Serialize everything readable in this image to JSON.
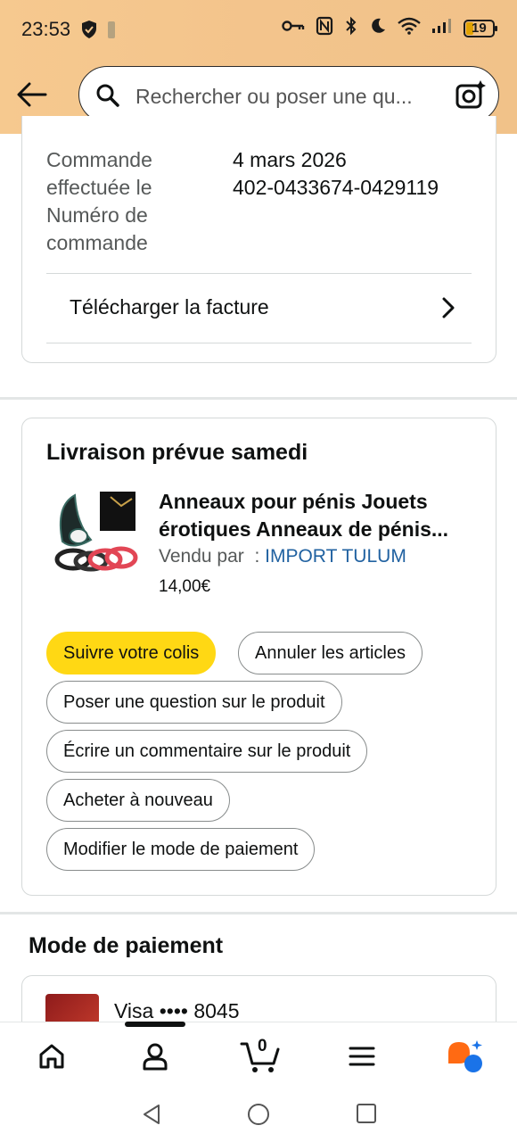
{
  "status_bar": {
    "time": "23:53",
    "battery": "19"
  },
  "header": {
    "search_placeholder": "Rechercher ou poser une qu..."
  },
  "order_info": {
    "label_date": "Commande effectuée le",
    "label_number": "Numéro de commande",
    "date": "4 mars 2026",
    "number": "402-0433674-0429119",
    "download_invoice": "Télécharger la facture"
  },
  "delivery": {
    "title": "Livraison prévue samedi",
    "product_title": "Anneaux pour pénis Jouets érotiques Anneaux de pénis...",
    "sold_by_label": "Vendu par",
    "seller_sep": ":",
    "seller": "IMPORT TULUM",
    "price": "14,00€",
    "actions": {
      "track": "Suivre votre colis",
      "cancel": "Annuler les articles",
      "question": "Poser une question sur le produit",
      "review": "Écrire un commentaire sur le produit",
      "buy_again": "Acheter à nouveau",
      "change_payment": "Modifier le mode de paiement"
    }
  },
  "payment": {
    "title": "Mode de paiement",
    "card_text": "Visa •••• 8045"
  },
  "bottom_nav": {
    "cart_count": "0"
  },
  "colors": {
    "header_bg": "#f4c68d",
    "primary_button": "#ffd814",
    "link": "#2162a1"
  }
}
